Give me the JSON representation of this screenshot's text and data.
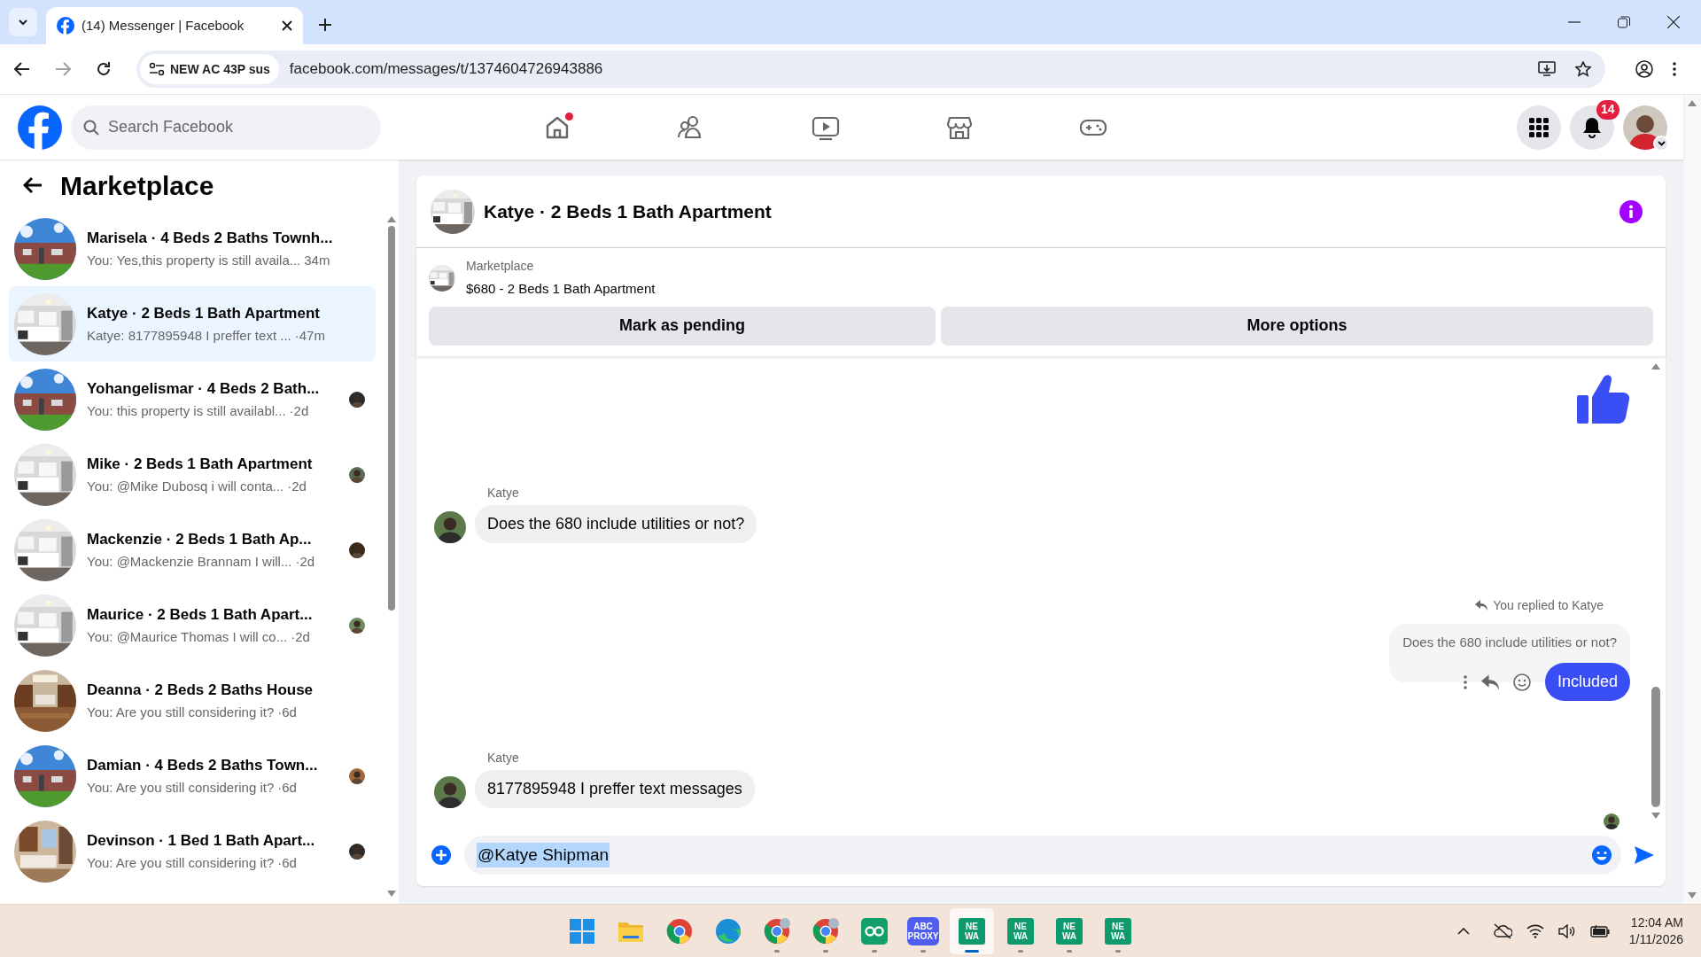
{
  "browser": {
    "tab_title": "(14) Messenger | Facebook",
    "site_chip": "NEW AC 43P sus",
    "url": "facebook.com/messages/t/1374604726943886"
  },
  "header": {
    "search_placeholder": "Search Facebook",
    "home_has_update": true,
    "notification_count": "14"
  },
  "sidebar": {
    "title": "Marketplace",
    "conversations": [
      {
        "title": "Marisela · 4 Beds 2 Baths Townh...",
        "preview": "You: Yes,this property is still availa...",
        "time": "34m",
        "selected": false,
        "seen_avatar": false
      },
      {
        "title": "Katye · 2 Beds 1 Bath Apartment",
        "preview": "Katye: 8177895948 I preffer text ...",
        "time": "·47m",
        "selected": true,
        "seen_avatar": false
      },
      {
        "title": "Yohangelismar · 4 Beds 2 Bath...",
        "preview": "You: this property is still availabl...",
        "time": "·2d",
        "selected": false,
        "seen_avatar": true
      },
      {
        "title": "Mike · 2 Beds 1 Bath Apartment",
        "preview": "You: @Mike Dubosq i will conta...",
        "time": "·2d",
        "selected": false,
        "seen_avatar": true
      },
      {
        "title": "Mackenzie · 2 Beds 1 Bath Ap...",
        "preview": "You: @Mackenzie Brannam I will...",
        "time": "·2d",
        "selected": false,
        "seen_avatar": true
      },
      {
        "title": "Maurice · 2 Beds 1 Bath Apart...",
        "preview": "You: @Maurice Thomas I will co...",
        "time": "·2d",
        "selected": false,
        "seen_avatar": true
      },
      {
        "title": "Deanna · 2 Beds 2 Baths House",
        "preview": "You: Are you still considering it?",
        "time": "·6d",
        "selected": false,
        "seen_avatar": false
      },
      {
        "title": "Damian · 4 Beds 2 Baths Town...",
        "preview": "You: Are you still considering it?",
        "time": "·6d",
        "selected": false,
        "seen_avatar": true
      },
      {
        "title": "Devinson · 1 Bed 1 Bath Apart...",
        "preview": "You: Are you still considering it?",
        "time": "·6d",
        "selected": false,
        "seen_avatar": true
      }
    ]
  },
  "chat": {
    "title": "Katye · 2 Beds 1 Bath Apartment",
    "listing": {
      "label": "Marketplace",
      "text": "$680 - 2 Beds 1 Bath Apartment"
    },
    "buttons": [
      "Mark as pending",
      "More options"
    ],
    "messages": [
      {
        "kind": "like"
      },
      {
        "kind": "incoming",
        "sender": "Katye",
        "text": "Does the 680 include utilities or not?"
      },
      {
        "kind": "reply",
        "note": "You replied to Katye",
        "quoted": "Does the 680 include utilities or not?",
        "text": "Included"
      },
      {
        "kind": "incoming",
        "sender": "Katye",
        "text": "8177895948 I preffer text messages"
      },
      {
        "kind": "seen"
      }
    ],
    "composer": {
      "value": "@Katye Shipman"
    }
  },
  "taskbar": {
    "apps": [
      {
        "kind": "start",
        "running": false,
        "selected": false
      },
      {
        "kind": "files",
        "running": false,
        "selected": false
      },
      {
        "kind": "chrome",
        "running": false,
        "selected": false
      },
      {
        "kind": "edge",
        "running": false,
        "selected": false
      },
      {
        "kind": "chrome",
        "running": true,
        "selected": false
      },
      {
        "kind": "chrome",
        "running": true,
        "selected": false
      },
      {
        "kind": "loop",
        "running": true,
        "selected": false
      },
      {
        "kind": "proxy",
        "label": "ABC PROXY",
        "running": true,
        "selected": false
      },
      {
        "kind": "tile",
        "label": "NE WA",
        "running": true,
        "selected": true
      },
      {
        "kind": "tile",
        "label": "NE WA",
        "running": true,
        "selected": false
      },
      {
        "kind": "tile",
        "label": "NE WA",
        "running": true,
        "selected": false
      },
      {
        "kind": "tile",
        "label": "NE WA",
        "running": true,
        "selected": false
      }
    ],
    "time": "12:04 AM",
    "date": "1/11/2026"
  }
}
